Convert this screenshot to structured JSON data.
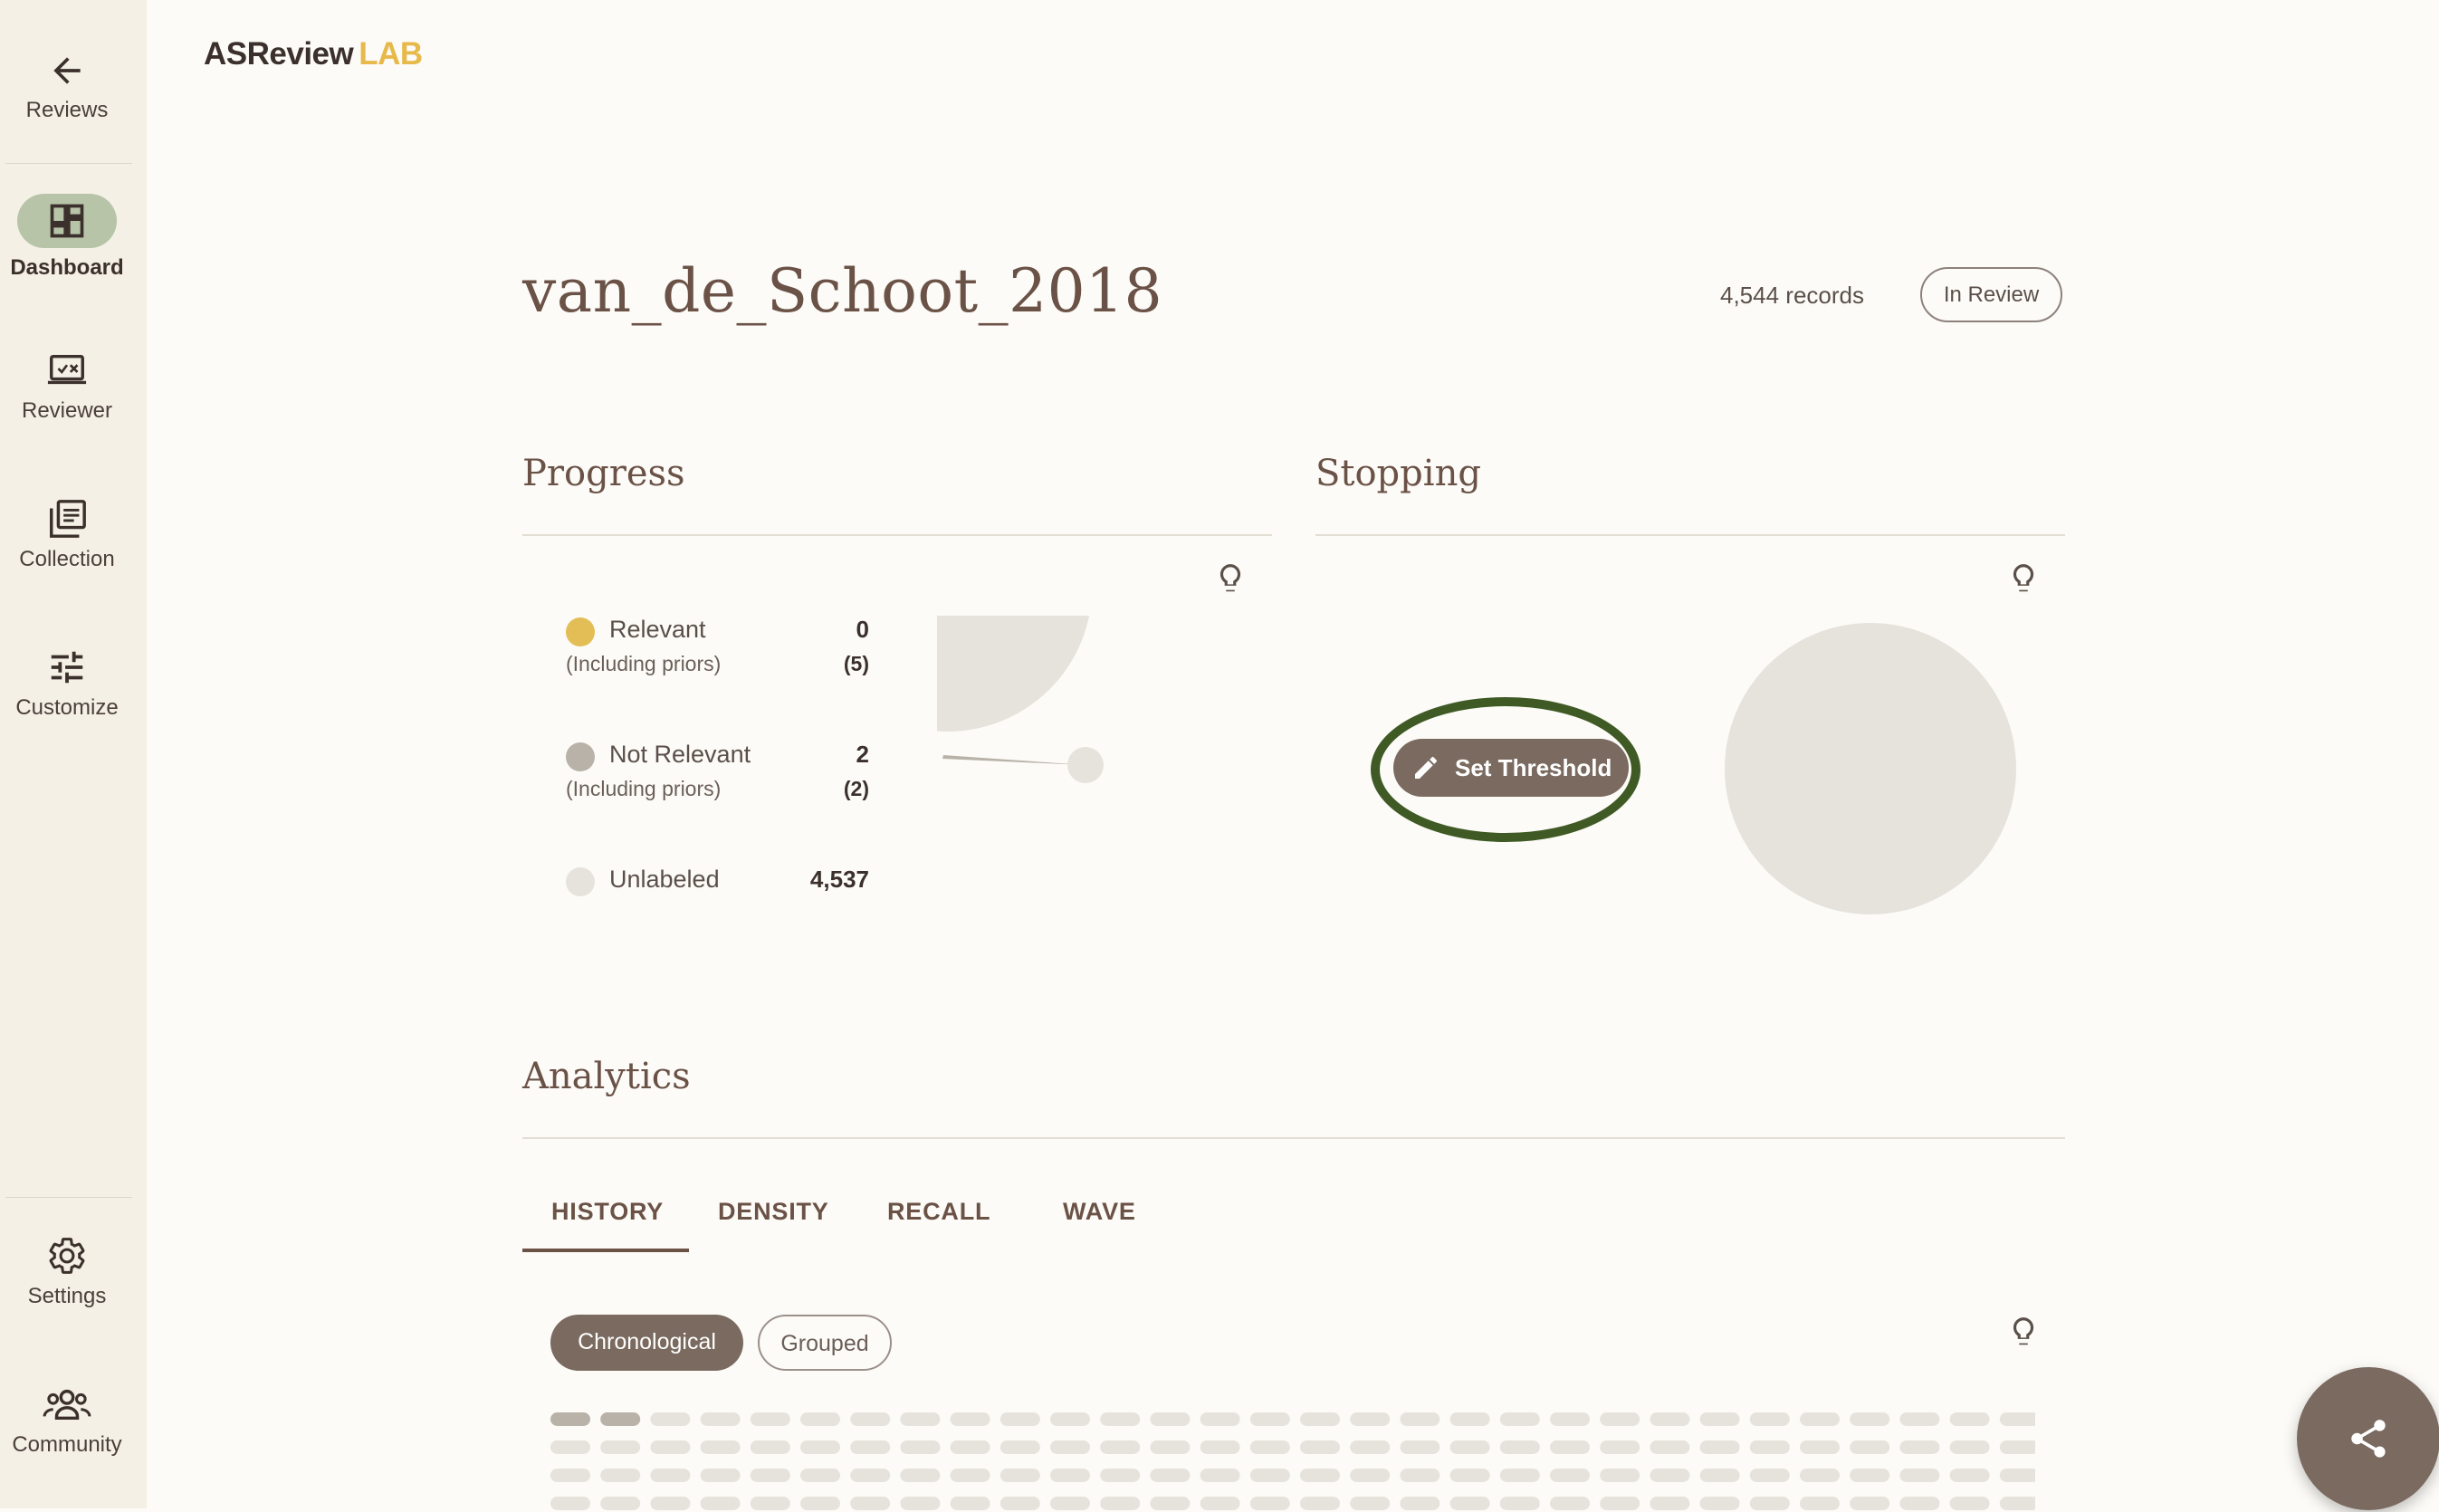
{
  "app": {
    "logo_main": "ASReview",
    "logo_accent": "LAB"
  },
  "sidebar": {
    "items": [
      {
        "label": "Reviews",
        "icon": "arrow-left-icon"
      },
      {
        "label": "Dashboard",
        "icon": "dashboard-icon",
        "active": true
      },
      {
        "label": "Reviewer",
        "icon": "reviewer-icon"
      },
      {
        "label": "Collection",
        "icon": "collection-icon"
      },
      {
        "label": "Customize",
        "icon": "tune-icon"
      }
    ],
    "bottom_items": [
      {
        "label": "Settings",
        "icon": "gear-icon"
      },
      {
        "label": "Community",
        "icon": "community-icon"
      }
    ]
  },
  "project": {
    "title": "van_de_Schoot_2018",
    "records": "4,544 records",
    "status": "In Review"
  },
  "progress": {
    "title": "Progress",
    "legend": [
      {
        "label": "Relevant",
        "value": "0",
        "sub_label": "(Including priors)",
        "sub_value": "(5)",
        "color": "#e3be56"
      },
      {
        "label": "Not Relevant",
        "value": "2",
        "sub_label": "(Including priors)",
        "sub_value": "(2)",
        "color": "#b8b2a8"
      },
      {
        "label": "Unlabeled",
        "value": "4,537",
        "color": "#e6e3dc"
      }
    ]
  },
  "stopping": {
    "title": "Stopping",
    "button_label": "Set Threshold"
  },
  "analytics": {
    "title": "Analytics",
    "tabs": [
      "HISTORY",
      "DENSITY",
      "RECALL",
      "WAVE"
    ],
    "active_tab": "HISTORY",
    "chips": [
      "Chronological",
      "Grouped"
    ],
    "active_chip": "Chronological"
  },
  "colors": {
    "accent": "#e7b94b",
    "brown": "#7a6a5f",
    "highlight_ring": "#3f5a25",
    "active_nav": "#b7c4a7"
  }
}
